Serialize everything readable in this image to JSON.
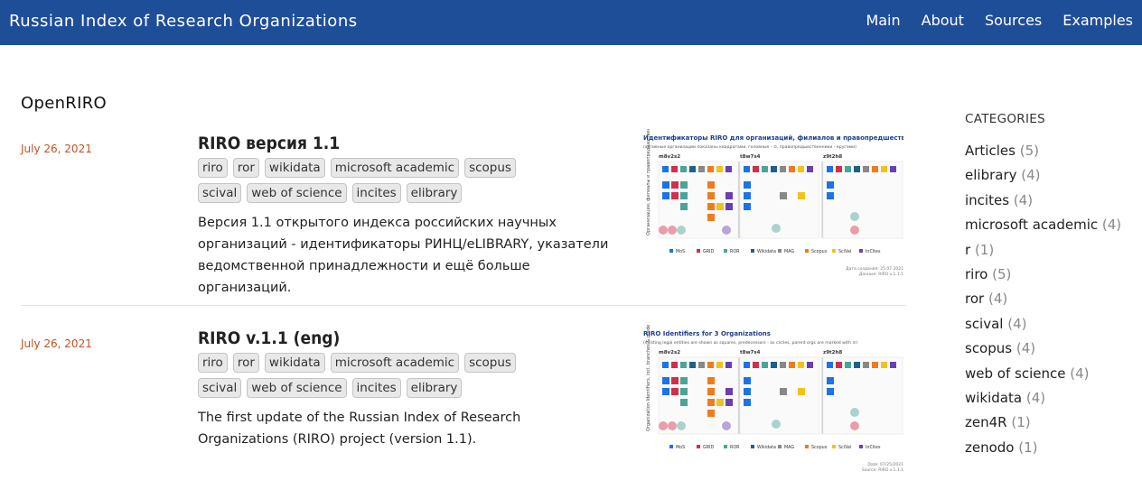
{
  "navbar": {
    "brand": "Russian Index of Research Organizations",
    "links": [
      "Main",
      "About",
      "Sources",
      "Examples"
    ]
  },
  "page_title": "OpenRIRO",
  "posts": [
    {
      "date": "July 26, 2021",
      "title": "RIRO версия 1.1",
      "tags": [
        "riro",
        "ror",
        "wikidata",
        "microsoft academic",
        "scopus",
        "scival",
        "web of science",
        "incites",
        "elibrary"
      ],
      "description": "Версия 1.1 открытого индекса российских научных организаций - идентификаторы РИНЦ/eLIBRARY, указатели ведомственной принадлежности и ещё больше организаций.",
      "thumbnail": {
        "title": "Идентификаторы RIRO для организаций, филиалов и правопредшественников",
        "subtitle": "(активные организации показаны квадратами, головные - ⊙, правопредшественники - кругами)",
        "ylabel": "Организации, филиалы и правопредшественники",
        "panels": [
          "m8v2s2",
          "t8w7s4",
          "z9t2h8"
        ],
        "legend": [
          "MoS",
          "GRID",
          "ROR",
          "Wikidata",
          "MAG",
          "Scopus",
          "SciVal",
          "InCites"
        ],
        "footer1": "Дата создания: 25.07.2021",
        "footer2": "Данные: RIRO v.1.1.1"
      }
    },
    {
      "date": "July 26, 2021",
      "title": "RIRO v.1.1 (eng)",
      "tags": [
        "riro",
        "ror",
        "wikidata",
        "microsoft academic",
        "scopus",
        "scival",
        "web of science",
        "incites",
        "elibrary"
      ],
      "description": "The first update of the Russian Index of Research Organizations (RIRO) project (version 1.1).",
      "thumbnail": {
        "title": "RIRO Identifiers for 3 Organizations",
        "subtitle": "(existing legal entities are shown as squares, predecessors - as circles, parent orgs are marked with ⊙)",
        "ylabel": "Organization Identifiers, incl. branches & predecessors",
        "panels": [
          "m8v2s2",
          "t8w7s4",
          "z9t2h8"
        ],
        "legend": [
          "MoS",
          "GRID",
          "ROR",
          "Wikidata",
          "MAG",
          "Scopus",
          "SciVal",
          "InCites"
        ],
        "footer1": "Date: 07/25/2021",
        "footer2": "Source: RIRO v.1.1.1"
      }
    }
  ],
  "sidebar": {
    "title": "CATEGORIES",
    "categories": [
      {
        "name": "Articles",
        "count": "(5)"
      },
      {
        "name": "elibrary",
        "count": "(4)"
      },
      {
        "name": "incites",
        "count": "(4)"
      },
      {
        "name": "microsoft academic",
        "count": "(4)"
      },
      {
        "name": "r",
        "count": "(1)"
      },
      {
        "name": "riro",
        "count": "(5)"
      },
      {
        "name": "ror",
        "count": "(4)"
      },
      {
        "name": "scival",
        "count": "(4)"
      },
      {
        "name": "scopus",
        "count": "(4)"
      },
      {
        "name": "web of science",
        "count": "(4)"
      },
      {
        "name": "wikidata",
        "count": "(4)"
      },
      {
        "name": "zen4R",
        "count": "(1)"
      },
      {
        "name": "zenodo",
        "count": "(1)"
      }
    ]
  },
  "colors": {
    "navbar": "#1f4e99",
    "date": "#c9501d",
    "legend": [
      "#1a73e8",
      "#d62d4a",
      "#4aa596",
      "#1f5f8b",
      "#888888",
      "#f07b1d",
      "#f2c21b",
      "#6a3fb0"
    ]
  }
}
